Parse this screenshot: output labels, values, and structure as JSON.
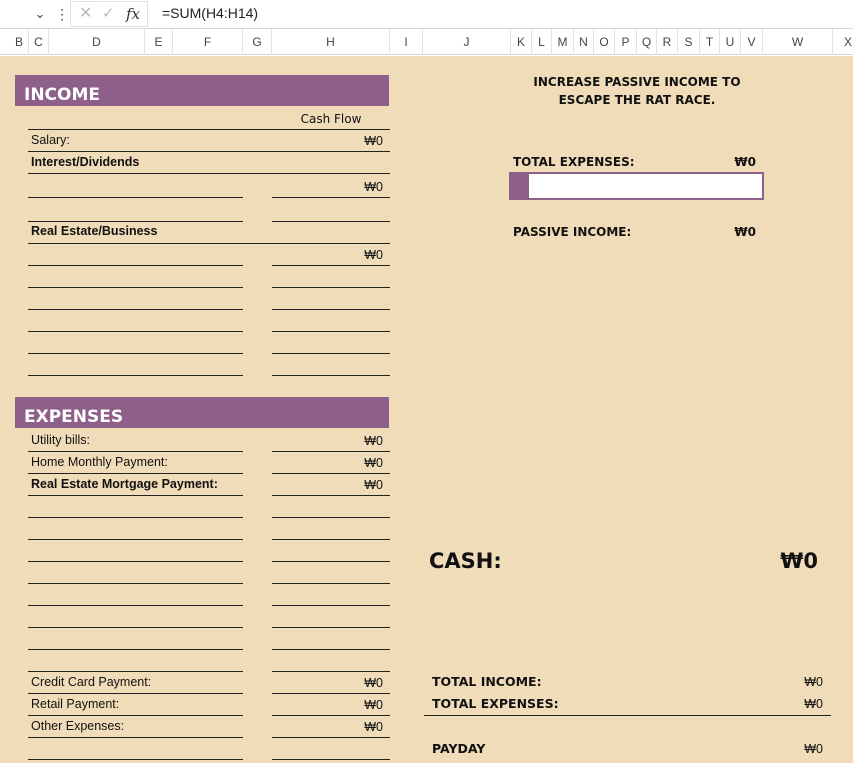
{
  "formula_bar": {
    "formula": "=SUM(H4:H14)",
    "name_dropdown_glyph": "⌄",
    "dots_glyph": "⋮",
    "cancel_glyph": "✕",
    "enter_glyph": "✓",
    "fx_glyph": "fx"
  },
  "columns": [
    "B",
    "C",
    "D",
    "E",
    "F",
    "G",
    "H",
    "I",
    "J",
    "K",
    "L",
    "M",
    "N",
    "O",
    "P",
    "Q",
    "R",
    "S",
    "T",
    "U",
    "V",
    "W",
    "X"
  ],
  "income": {
    "title": "INCOME",
    "cash_flow_header": "Cash Flow",
    "salary_label": "Salary:",
    "salary_value": "₩0",
    "interest_label": "Interest/Dividends",
    "interest_value": "₩0",
    "real_estate_label": "Real Estate/Business",
    "real_estate_value": "₩0"
  },
  "expenses": {
    "title": "EXPENSES",
    "utility_label": "Utility bills:",
    "utility_value": "₩0",
    "home_label": "Home Monthly Payment:",
    "home_value": "₩0",
    "mortgage_label": "Real Estate Mortgage Payment:",
    "mortgage_value": "₩0",
    "credit_label": "Credit Card Payment:",
    "credit_value": "₩0",
    "retail_label": "Retail Payment:",
    "retail_value": "₩0",
    "other_label": "Other Expenses:",
    "other_value": "₩0"
  },
  "panel": {
    "headline_line1": "INCREASE PASSIVE INCOME TO",
    "headline_line2": "ESCAPE THE RAT RACE.",
    "total_expenses_label": "TOTAL EXPENSES:",
    "total_expenses_value": "₩0",
    "progress_fraction": 0.07,
    "passive_income_label": "PASSIVE INCOME:",
    "passive_income_value": "₩0"
  },
  "summary": {
    "cash_label": "CASH:",
    "cash_value": "₩0",
    "total_income_label": "TOTAL INCOME:",
    "total_income_value": "₩0",
    "total_expenses_label": "TOTAL EXPENSES:",
    "total_expenses_value": "₩0",
    "payday_label": "PAYDAY",
    "payday_value": "₩0"
  },
  "colors": {
    "sheet_background": "#f0dcb9",
    "accent_purple": "#8e5f88"
  }
}
